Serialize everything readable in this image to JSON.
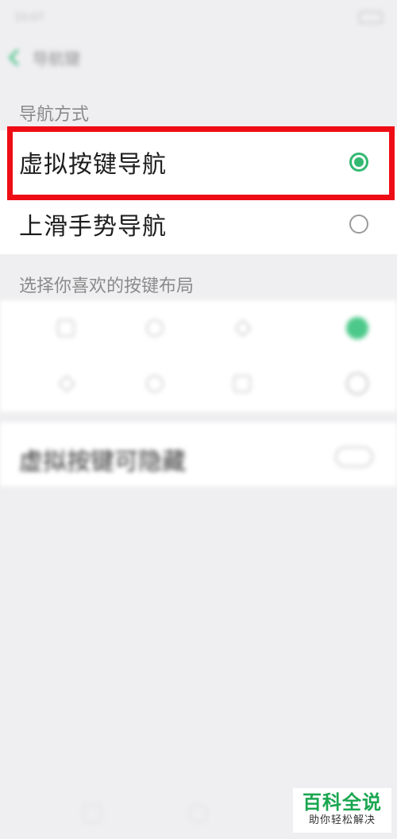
{
  "status_bar": {
    "time": "10:07"
  },
  "header": {
    "title": "导航键"
  },
  "navigation": {
    "section_label": "导航方式",
    "options": [
      {
        "label": "虚拟按键导航",
        "selected": true
      },
      {
        "label": "上滑手势导航",
        "selected": false
      }
    ]
  },
  "layout": {
    "section_label": "选择你喜欢的按键布局",
    "rows": [
      {
        "selected": true
      },
      {
        "selected": false
      }
    ]
  },
  "hide_keys": {
    "label": "虚拟按键可隐藏",
    "enabled": false
  },
  "watermark": {
    "title": "百科全说",
    "subtitle": "助你轻松解决"
  },
  "colors": {
    "accent": "#33b872",
    "highlight": "#ef0d15",
    "background": "#efeff1"
  }
}
